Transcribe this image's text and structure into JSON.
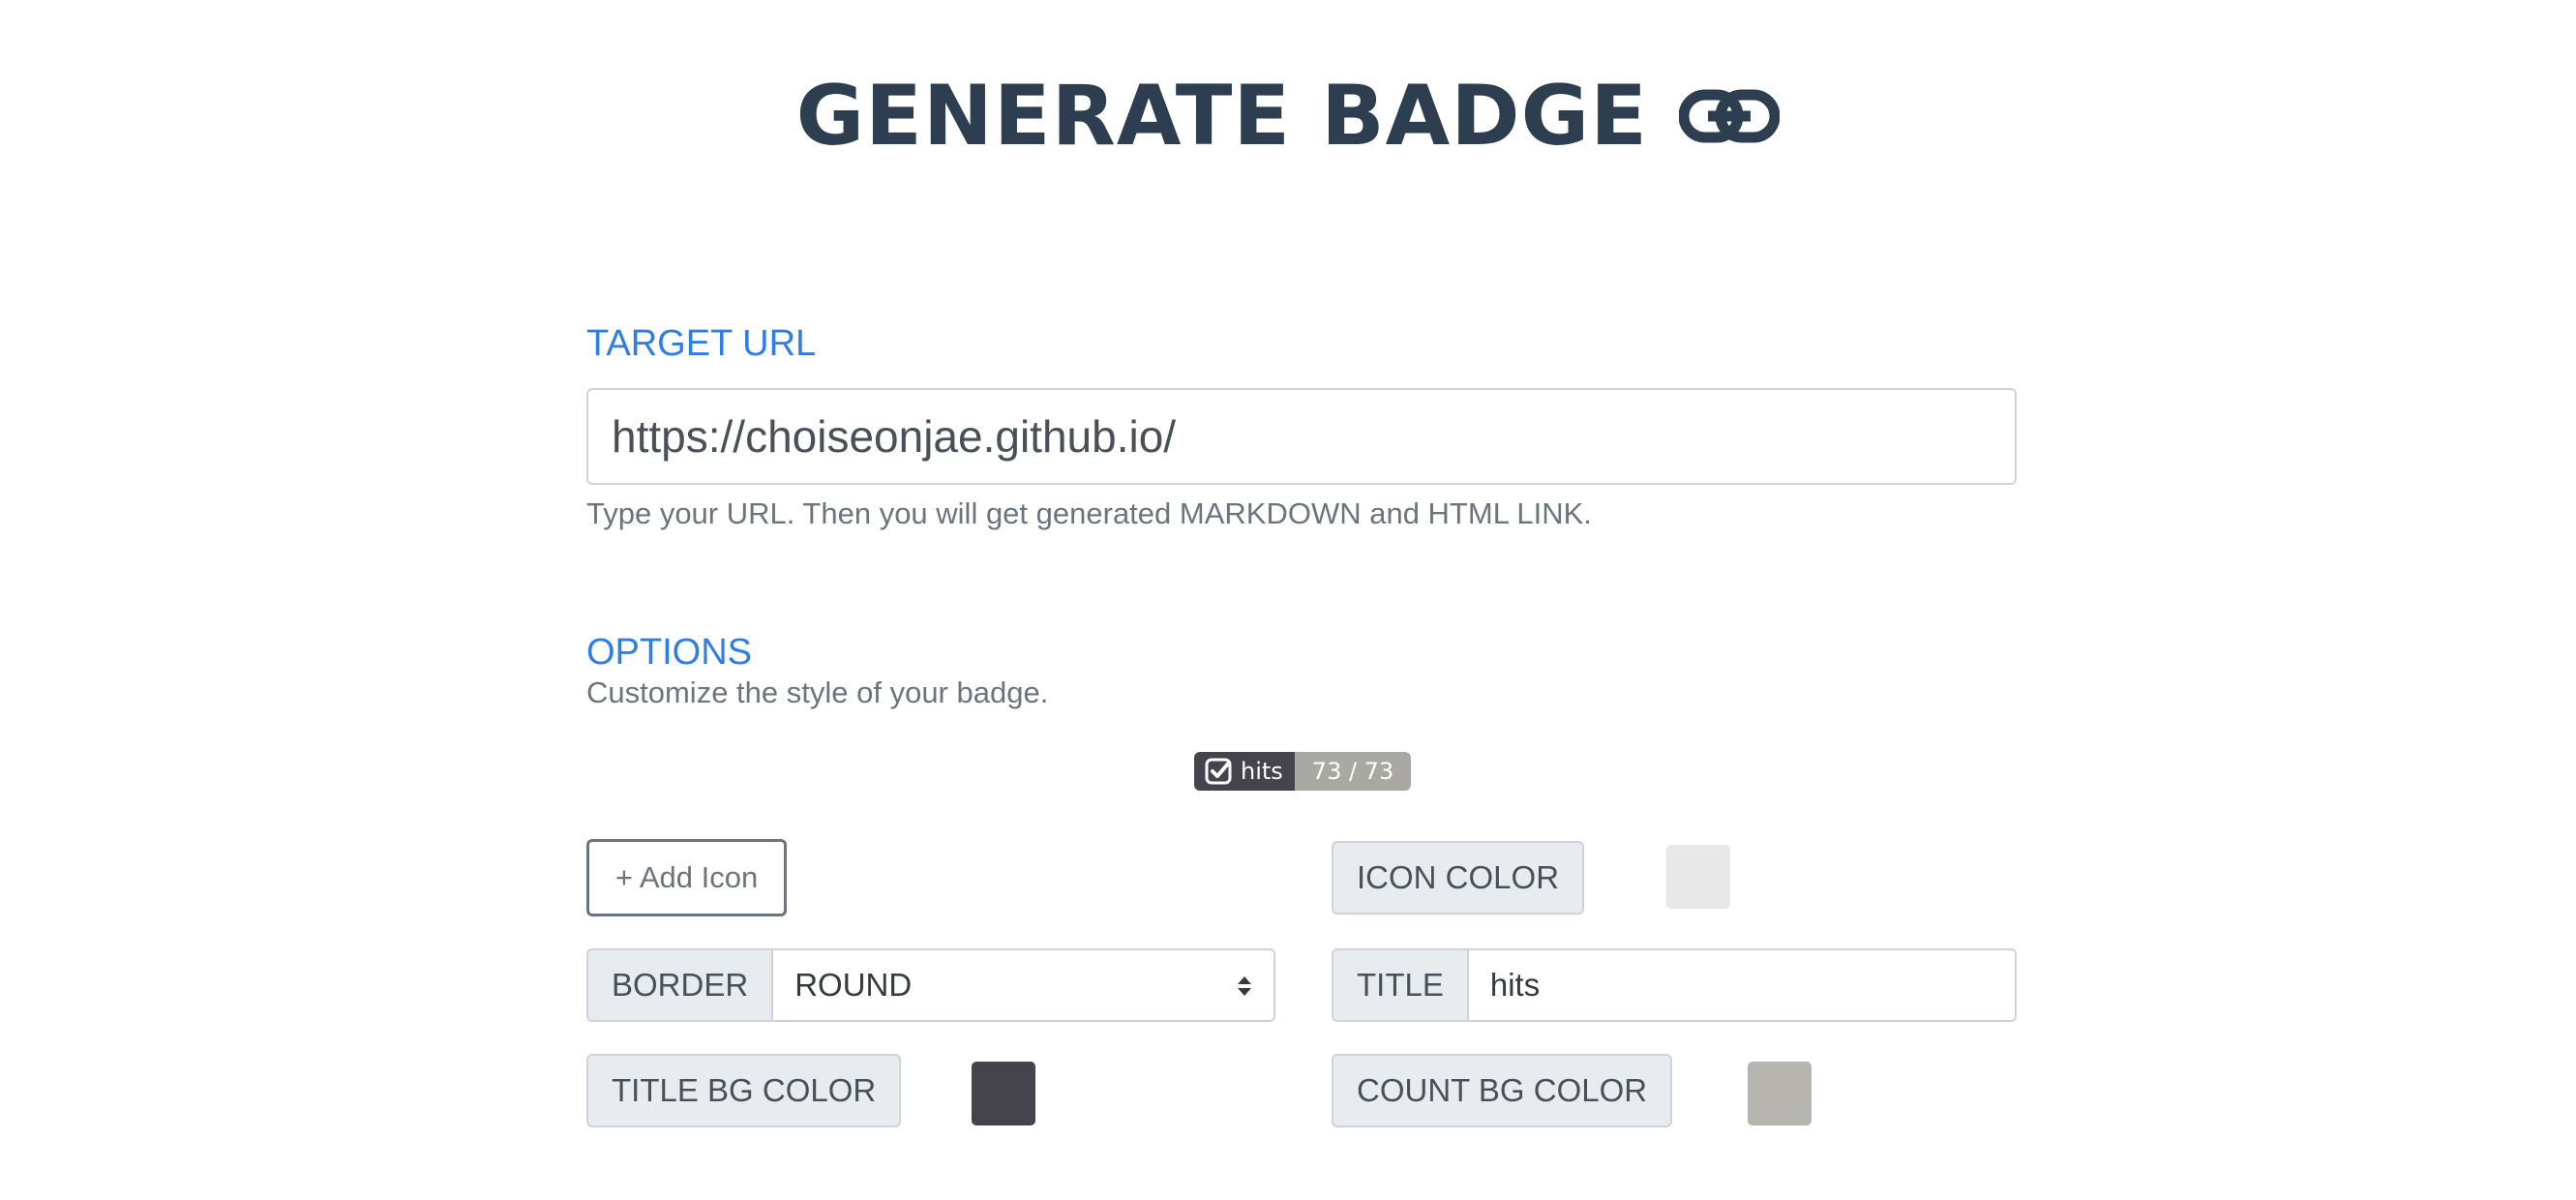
{
  "header": {
    "title": "GENERATE BADGE",
    "icon": "link-icon"
  },
  "target": {
    "label": "TARGET URL",
    "url_value": "https://choiseonjae.github.io/",
    "help": "Type your URL. Then you will get generated MARKDOWN and HTML LINK."
  },
  "options": {
    "label": "OPTIONS",
    "help": "Customize the style of your badge.",
    "badge_preview": {
      "icon": "check-square-icon",
      "title": "hits",
      "count": "73 / 73"
    },
    "add_icon_label": "+ Add Icon",
    "icon_color": {
      "label": "ICON COLOR",
      "value": "#e8e8e8"
    },
    "border": {
      "label": "BORDER",
      "selected": "ROUND"
    },
    "title_field": {
      "label": "TITLE",
      "value": "hits"
    },
    "title_bg_color": {
      "label": "TITLE BG COLOR",
      "value": "#45434b"
    },
    "count_bg_color": {
      "label": "COUNT BG COLOR",
      "value": "#b5b4af"
    }
  },
  "colors": {
    "heading": "#2c3e50",
    "accent": "#2f7ee6",
    "muted": "#6c757d"
  }
}
